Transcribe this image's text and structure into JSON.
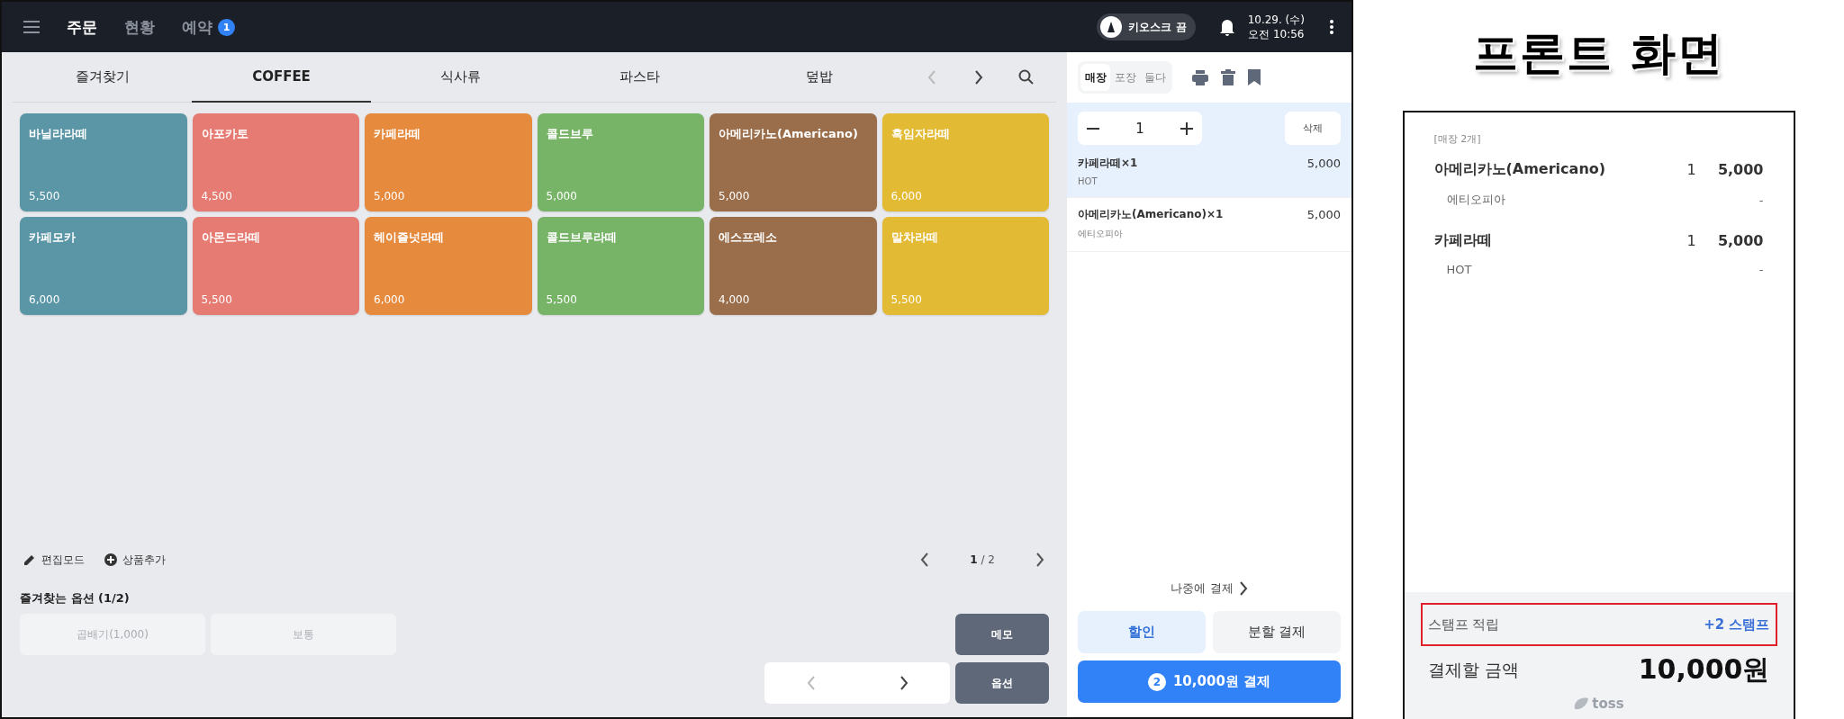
{
  "top_bar": {
    "nav": [
      {
        "label": "주문",
        "selected": true
      },
      {
        "label": "현황",
        "selected": false
      },
      {
        "label": "예약",
        "selected": false,
        "badge": "1"
      }
    ],
    "kiosk_toggle": {
      "label": "키오스크 끔",
      "on": false
    },
    "date": "10.29. (수)",
    "time": "오전 10:56"
  },
  "category_tabs": [
    {
      "label": "즐겨찾기",
      "selected": false
    },
    {
      "label": "COFFEE",
      "selected": true
    },
    {
      "label": "식사류",
      "selected": false
    },
    {
      "label": "파스타",
      "selected": false
    },
    {
      "label": "덮밥",
      "selected": false
    }
  ],
  "products": [
    {
      "name": "바닐라라떼",
      "price": "5,500",
      "color": "#5a96a6"
    },
    {
      "name": "아포카토",
      "price": "4,500",
      "color": "#e57b72"
    },
    {
      "name": "카페라떼",
      "price": "5,000",
      "color": "#e68a3e"
    },
    {
      "name": "콜드브루",
      "price": "5,000",
      "color": "#78b468"
    },
    {
      "name": "아메리카노(Americano)",
      "price": "5,000",
      "color": "#9a6e4a"
    },
    {
      "name": "흑임자라떼",
      "price": "6,000",
      "color": "#e3ba34"
    },
    {
      "name": "카페모카",
      "price": "6,000",
      "color": "#5a96a6"
    },
    {
      "name": "아몬드라떼",
      "price": "5,500",
      "color": "#e57b72"
    },
    {
      "name": "헤이즐넛라떼",
      "price": "6,000",
      "color": "#e68a3e"
    },
    {
      "name": "콜드브루라떼",
      "price": "5,500",
      "color": "#78b468"
    },
    {
      "name": "에스프레소",
      "price": "4,000",
      "color": "#9a6e4a"
    },
    {
      "name": "말차라떼",
      "price": "5,500",
      "color": "#e3ba34"
    }
  ],
  "toolbar": {
    "edit_mode": "편집모드",
    "add_product": "상품추가",
    "page_current": "1",
    "page_total": "/ 2"
  },
  "favorite_options": {
    "title": "즐겨찾는 옵션 (1/2)",
    "options": [
      {
        "label": "곱배기(1,000)",
        "disabled": true
      },
      {
        "label": "보통",
        "disabled": true
      }
    ]
  },
  "memo_button": "메모",
  "option_button": "옵션",
  "order": {
    "order_types": [
      {
        "label": "매장",
        "selected": true
      },
      {
        "label": "포장",
        "selected": false
      },
      {
        "label": "둘다",
        "selected": false
      }
    ],
    "quantity": "1",
    "delete_button": "삭제",
    "items": [
      {
        "name": "카페라떼×1",
        "price": "5,000",
        "option": "HOT",
        "selected": true
      },
      {
        "name": "아메리카노(Americano)×1",
        "price": "5,000",
        "option": "에티오피아",
        "selected": false
      }
    ],
    "pay_later": "나중에 결제",
    "discount_button": "할인",
    "split_button": "분할 결제",
    "pay_button": {
      "count": "2",
      "label": "10,000원 결제"
    }
  },
  "front_screen": {
    "title": "프론트 화면",
    "summary": "[매장 2개]",
    "items": [
      {
        "name": "아메리카노(Americano)",
        "qty": "1",
        "price": "5,000",
        "option": "에티오피아",
        "option_price": "-"
      },
      {
        "name": "카페라떼",
        "qty": "1",
        "price": "5,000",
        "option": "HOT",
        "option_price": "-"
      }
    ],
    "stamp": {
      "label": "스탬프 적립",
      "value": "+2 스탬프"
    },
    "total": {
      "label": "결제할 금액",
      "value": "10,000원"
    },
    "brand": "toss"
  }
}
